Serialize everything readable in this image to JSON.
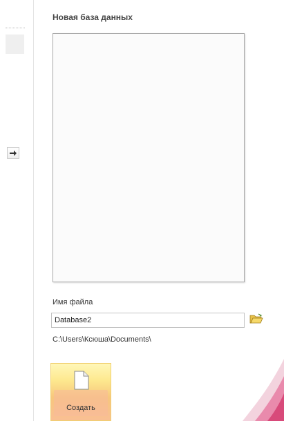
{
  "panel": {
    "title": "Новая база данных"
  },
  "file": {
    "label": "Имя файла",
    "value": "Database2",
    "path": "C:\\Users\\Ксюша\\Documents\\"
  },
  "create_button": {
    "label": "Создать"
  },
  "icons": {
    "arrow": "arrow-right-icon",
    "folder": "folder-open-icon",
    "document": "blank-document-icon"
  },
  "colors": {
    "create_top": "#fff7b8",
    "create_bottom": "#f9bf94",
    "swoosh": "#d84a7a"
  }
}
